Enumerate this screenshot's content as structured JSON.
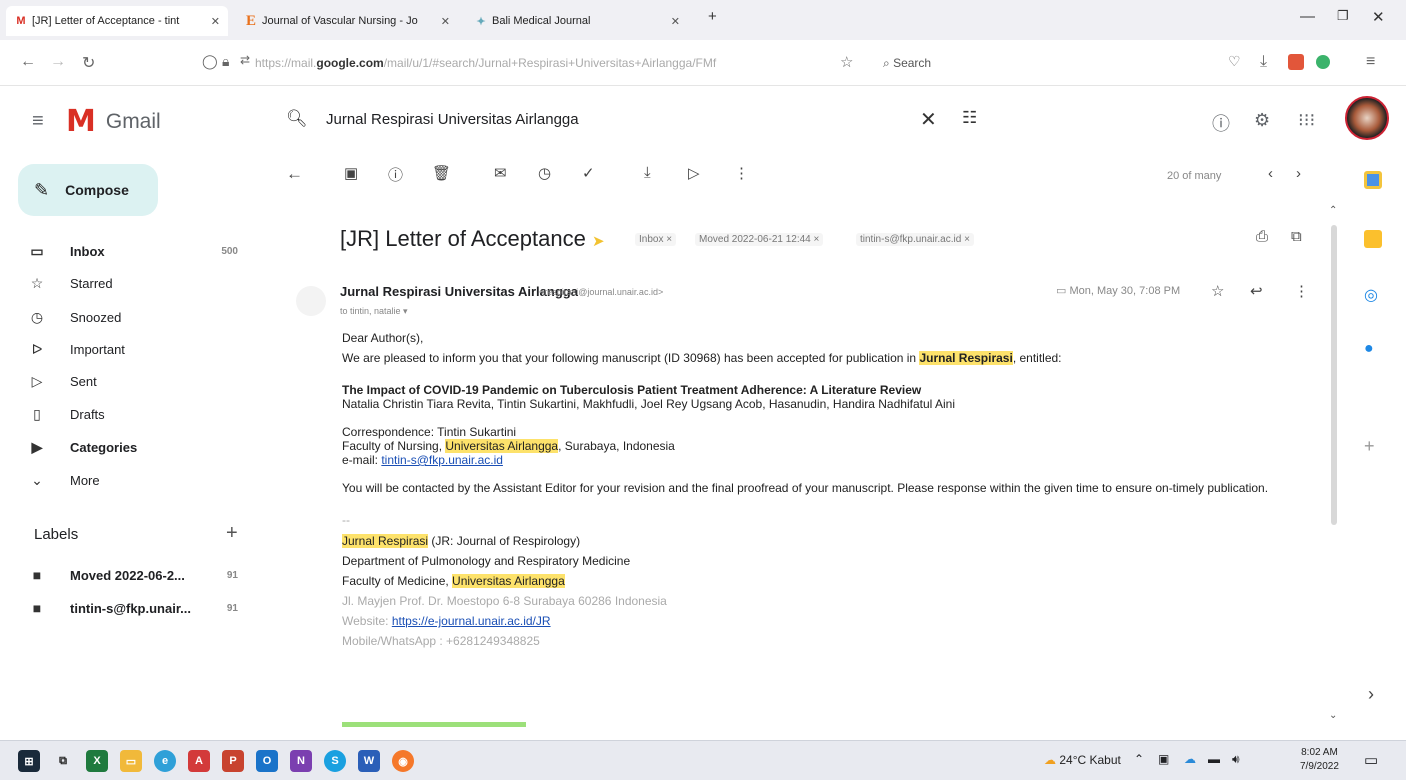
{
  "browser": {
    "tabs": [
      {
        "label": "[JR] Letter of Acceptance - tint",
        "favicon": "gmail-icon"
      },
      {
        "label": "Journal of Vascular Nursing - Jo",
        "favicon": "elsevier-icon"
      },
      {
        "label": "Bali Medical Journal",
        "favicon": "journal-icon"
      }
    ],
    "url_prefix": "https://mail.",
    "url_domain": "google.com",
    "url_rest": "/mail/u/1/#search/Jurnal+Respirasi+Universitas+Airlangga/FMf",
    "search_placeholder": "Search"
  },
  "gmail": {
    "logo_text": "Gmail",
    "search_value": "Jurnal Respirasi Universitas Airlangga",
    "compose_label": "Compose",
    "nav": [
      {
        "label": "Inbox",
        "count": "500",
        "icon": "inbox-icon"
      },
      {
        "label": "Starred",
        "count": "",
        "icon": "star-icon"
      },
      {
        "label": "Snoozed",
        "count": "",
        "icon": "clock-icon"
      },
      {
        "label": "Important",
        "count": "",
        "icon": "important-icon"
      },
      {
        "label": "Sent",
        "count": "",
        "icon": "send-icon"
      },
      {
        "label": "Drafts",
        "count": "",
        "icon": "draft-icon"
      },
      {
        "label": "Categories",
        "count": "",
        "icon": "label-icon"
      },
      {
        "label": "More",
        "count": "",
        "icon": "chevron-down-icon"
      }
    ],
    "labels_header": "Labels",
    "labels": [
      {
        "label": "Moved 2022-06-2...",
        "count": "91"
      },
      {
        "label": "tintin-s@fkp.unair...",
        "count": "91"
      }
    ],
    "pager": "20 of many"
  },
  "email": {
    "subject": "[JR] Letter of Acceptance",
    "chips": [
      "Inbox",
      "Moved 2022-06-21 12:44",
      "tintin-s@fkp.unair.ac.id"
    ],
    "sender_name": "Jurnal Respirasi Universitas Airlangga",
    "sender_email": "<respirasi@journal.unair.ac.id>",
    "to": "to tintin, natalie",
    "datetime": "Mon, May 30, 7:08 PM",
    "greeting": "Dear Author(s),",
    "intro_a": "We are pleased to inform you that your following manuscript (ID 30968) has been accepted for publication in ",
    "intro_hl": "Jurnal Respirasi",
    "intro_b": ", entitled:",
    "article_title": "The Impact of COVID-19 Pandemic on Tuberculosis Patient Treatment Adherence: A Literature Review",
    "authors": "Natalia Christin Tiara Revita, Tintin Sukartini, Makhfudli, Joel Rey Ugsang Acob, Hasanudin, Handira Nadhifatul Aini",
    "corr_line": "Correspondence: Tintin Sukartini",
    "corr_aff_a": "Faculty of Nursing, ",
    "corr_aff_hl": "Universitas Airlangga",
    "corr_aff_b": ", Surabaya, Indonesia",
    "corr_email_label": "e-mail: ",
    "corr_email": "tintin-s@fkp.unair.ac.id",
    "closing": "You will be contacted by the Assistant Editor for your revision and the final proofread of your manuscript. Please response within the given time to ensure on-timely publication.",
    "sig_sep": "--",
    "sig_name_hl": "Jurnal Respirasi",
    "sig_name_rest": " (JR: Journal of Respirology)",
    "sig_dept": "Department of Pulmonology and Respiratory Medicine",
    "sig_fac_a": "Faculty of Medicine, ",
    "sig_fac_hl": "Universitas Airlangga",
    "sig_address": "Jl. Mayjen Prof. Dr. Moestopo 6-8 Surabaya 60286 Indonesia",
    "sig_web_label": "Website: ",
    "sig_web": "https://e-journal.unair.ac.id/JR",
    "sig_phone": "Mobile/WhatsApp : +6281249348825"
  },
  "taskbar": {
    "weather": "24°C  Kabut",
    "time": "8:02 AM",
    "date": "7/9/2022"
  },
  "colors": {
    "highlight": "#fde26b",
    "compose_bg": "#dcf2f2",
    "gmail_red": "#d93025"
  }
}
